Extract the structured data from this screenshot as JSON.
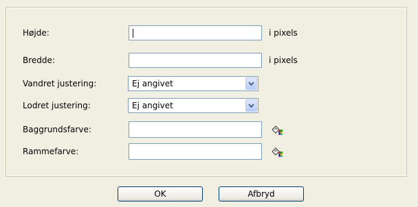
{
  "form": {
    "height": {
      "label": "Højde:",
      "value": "",
      "unit": "i pixels"
    },
    "width": {
      "label": "Bredde:",
      "value": "",
      "unit": "i pixels"
    },
    "horizontal_alignment": {
      "label": "Vandret justering:",
      "selected": "Ej angivet"
    },
    "vertical_alignment": {
      "label": "Lodret justering:",
      "selected": "Ej angivet"
    },
    "background_color": {
      "label": "Baggrundsfarve:",
      "value": "",
      "picker_icon": "color-picker-icon"
    },
    "border_color": {
      "label": "Rammefarve:",
      "value": "",
      "picker_icon": "color-picker-icon"
    }
  },
  "buttons": {
    "ok_label": "OK",
    "cancel_label": "Afbryd"
  },
  "colors": {
    "background": "#f1efe2",
    "input_border": "#7f9db9",
    "button_border": "#003c74",
    "dropdown_arrow": "#4d6185"
  }
}
